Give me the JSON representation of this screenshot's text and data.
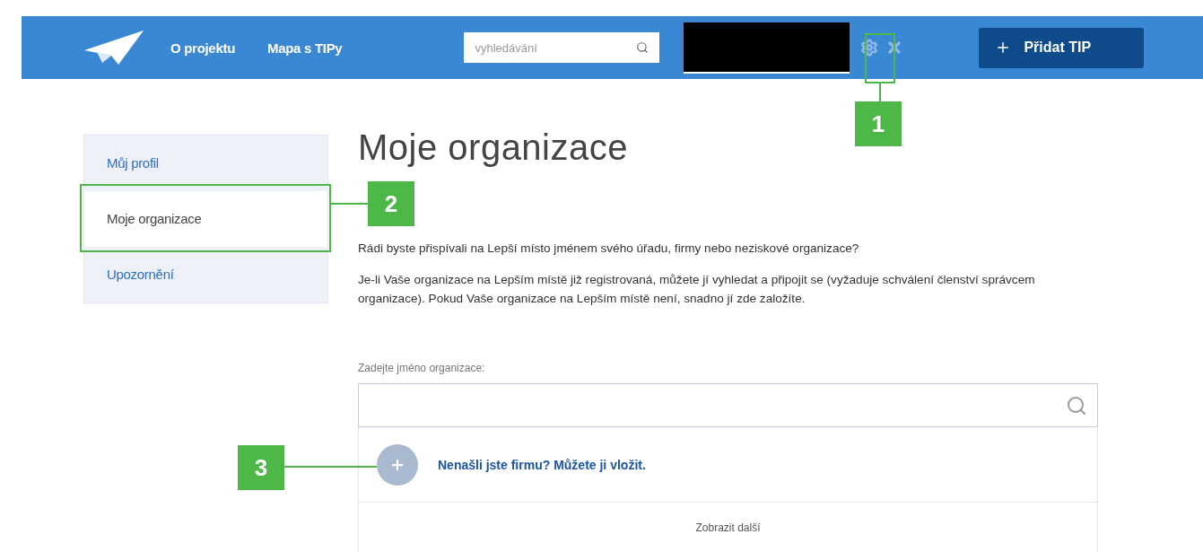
{
  "header": {
    "nav": [
      {
        "label": "O projektu"
      },
      {
        "label": "Mapa s TIPy"
      }
    ],
    "search": {
      "placeholder": "vyhledávání"
    },
    "add_button": {
      "label": "Přidat TIP"
    }
  },
  "sidebar": {
    "items": [
      {
        "label": "Můj profil",
        "selected": false
      },
      {
        "label": "Moje organizace",
        "selected": true
      },
      {
        "label": "Upozornění",
        "selected": false
      }
    ]
  },
  "main": {
    "title": "Moje organizace",
    "paragraphs": [
      "Rádi byste přispívali na Lepší místo jménem svého úřadu, firmy nebo neziskové organizace?",
      "Je-li Vaše organizace na Lepším místě již registrovaná, můžete jí vyhledat a připojit se (vyžaduje schválení členství správcem organizace). Pokud Vaše organizace na Lepším místě není, snadno jí zde založíte."
    ],
    "field_label": "Zadejte jméno organizace:",
    "add_link": "Nenašli jste firmu? Můžete ji vložit.",
    "show_more": "Zobrazit další"
  },
  "callouts": [
    {
      "label": "1"
    },
    {
      "label": "2"
    },
    {
      "label": "3"
    }
  ]
}
